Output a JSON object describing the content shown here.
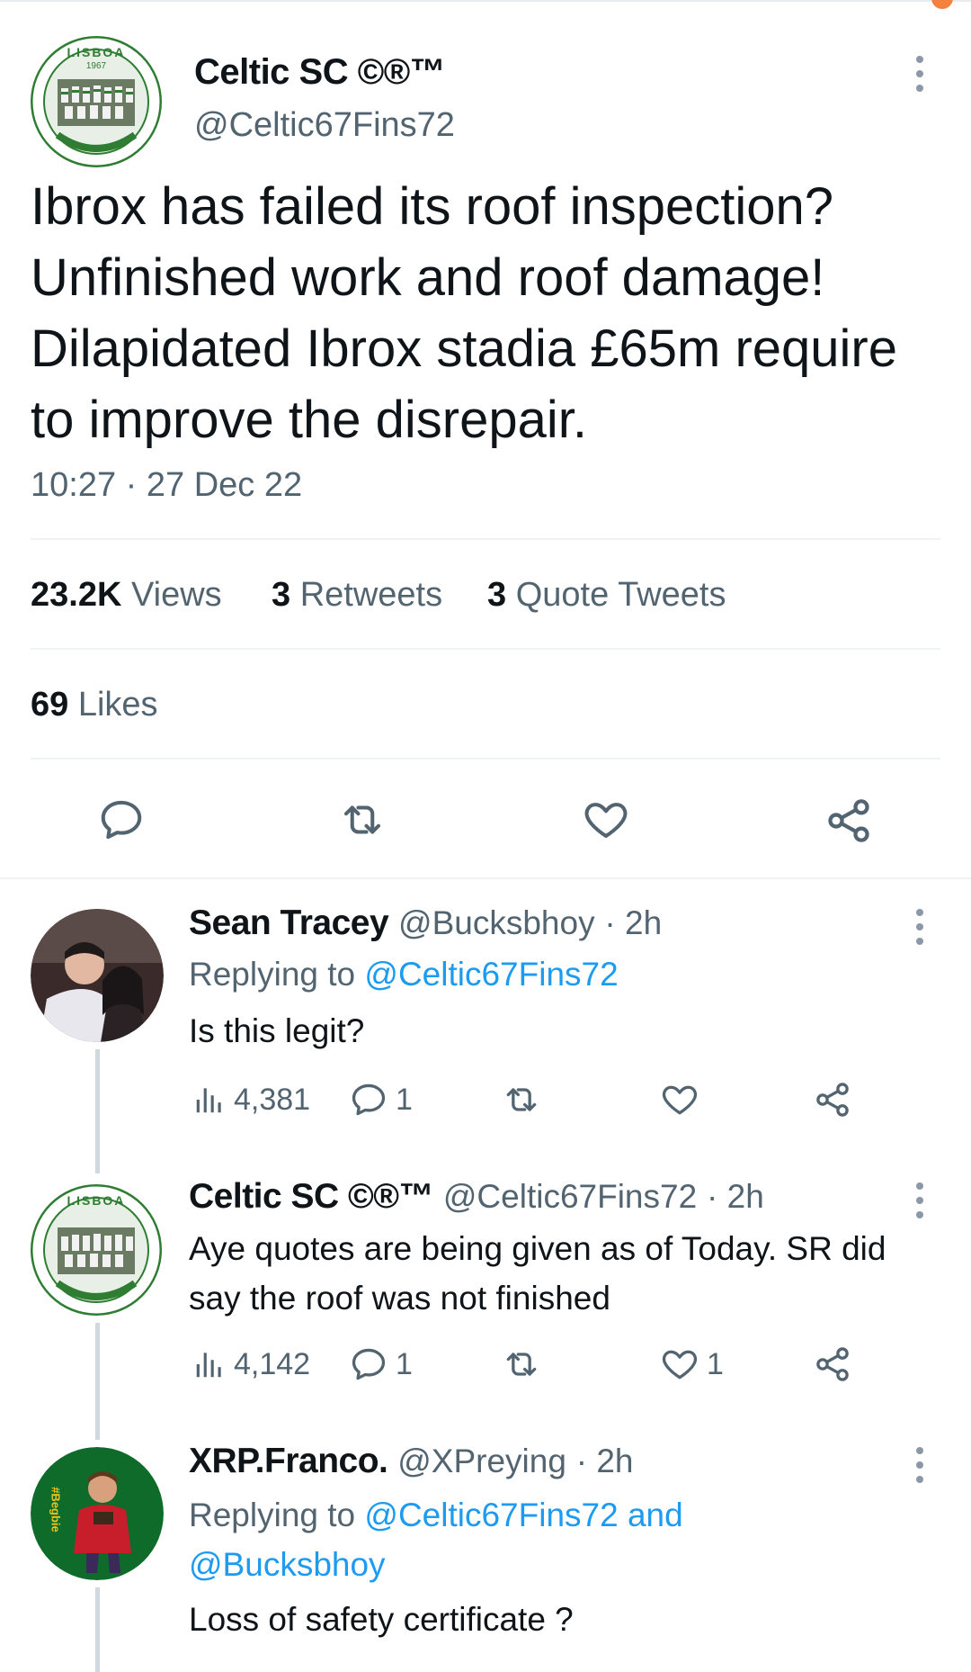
{
  "main_tweet": {
    "author_name": "Celtic SC ©®™",
    "author_handle": "@Celtic67Fins72",
    "avatar_text": "LISBOA",
    "avatar_year": "1967",
    "text": "Ibrox has failed its roof inspection? Unfinished work and roof damage! Dilapidated Ibrox stadia £65m require to improve the disrepair.",
    "timestamp": "10:27 · 27 Dec 22",
    "views_count": "23.2K",
    "views_label": "Views",
    "retweets_count": "3",
    "retweets_label": "Retweets",
    "quotes_count": "3",
    "quotes_label": "Quote Tweets",
    "likes_count": "69",
    "likes_label": "Likes"
  },
  "replies": [
    {
      "author_name": "Sean Tracey",
      "author_handle": "@Bucksbhoy",
      "time": "· 2h",
      "replying_prefix": "Replying to",
      "replying_to": "@Celtic67Fins72",
      "text": "Is this legit?",
      "views": "4,381",
      "replies": "1",
      "retweets": "",
      "likes": ""
    },
    {
      "author_name": "Celtic SC ©®™",
      "author_handle": "@Celtic67Fins72",
      "time": "· 2h",
      "text": "Aye quotes are being given as of Today. SR did say the roof was not finished",
      "views": "4,142",
      "replies": "1",
      "retweets": "",
      "likes": "1"
    },
    {
      "author_name": "XRP.Franco.",
      "author_handle": "@XPreying",
      "time": "· 2h",
      "replying_prefix": "Replying to",
      "replying_to": "@Celtic67Fins72 and @Bucksbhoy",
      "avatar_text": "#Begbie",
      "text": "Loss of safety certificate ?"
    }
  ],
  "colors": {
    "link_blue": "#1d9bf0",
    "secondary_text": "#536471",
    "celtic_green": "#2e7d32",
    "notification_orange": "#f4813f"
  }
}
